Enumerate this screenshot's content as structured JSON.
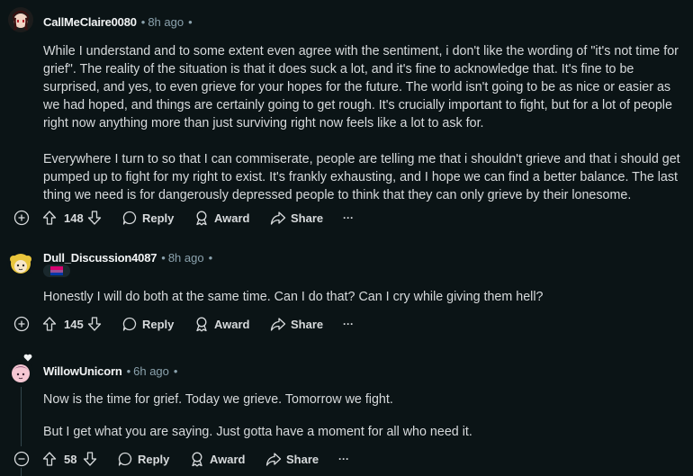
{
  "comments": [
    {
      "author": "CallMeClaire0080",
      "age": "8h ago",
      "paragraphs": [
        "While I understand and to some extent even agree with the sentiment, i don't like the wording of \"it's not time for grief\". The reality of the situation is that it does suck a lot, and it's fine to acknowledge that. It's fine to be surprised, and yes, to even grieve for your hopes for the future. The world isn't going to be as nice or easier as we had hoped, and things are certainly going to get rough. It's crucially important to fight, but for a lot of people right now anything more than just surviving right now feels like a lot to ask for.",
        "Everywhere I turn to so that I can commiserate, people are telling me that i shouldn't grieve and that i should get pumped up to fight for my right to exist. It's frankly exhausting, and I hope we can find a better balance. The last thing we need is for dangerously depressed people to think that they can only grieve by their lonesome."
      ],
      "votes": "148",
      "toggle": "+"
    },
    {
      "author": "Dull_Discussion4087",
      "age": "8h ago",
      "paragraphs": [
        "Honestly I will do both at the same time. Can I do that? Can I cry while giving them hell?"
      ],
      "votes": "145",
      "toggle": "+"
    },
    {
      "author": "WillowUnicorn",
      "age": "6h ago",
      "paragraphs": [
        "Now is the time for grief. Today we grieve. Tomorrow we fight.",
        "But I get what you are saying. Just gotta have a moment for all who need it."
      ],
      "votes": "58",
      "toggle": "−"
    }
  ],
  "labels": {
    "reply": "Reply",
    "award": "Award",
    "share": "Share",
    "more": "···",
    "dot": "•"
  },
  "icons": [
    "upvote-icon",
    "downvote-icon",
    "reply-icon",
    "award-icon",
    "share-icon",
    "expand-icon",
    "collapse-icon"
  ],
  "colors": {
    "background": "#0b1416",
    "text": "#d7dadc",
    "muted": "#8ba2ad",
    "rail": "#33464c"
  }
}
